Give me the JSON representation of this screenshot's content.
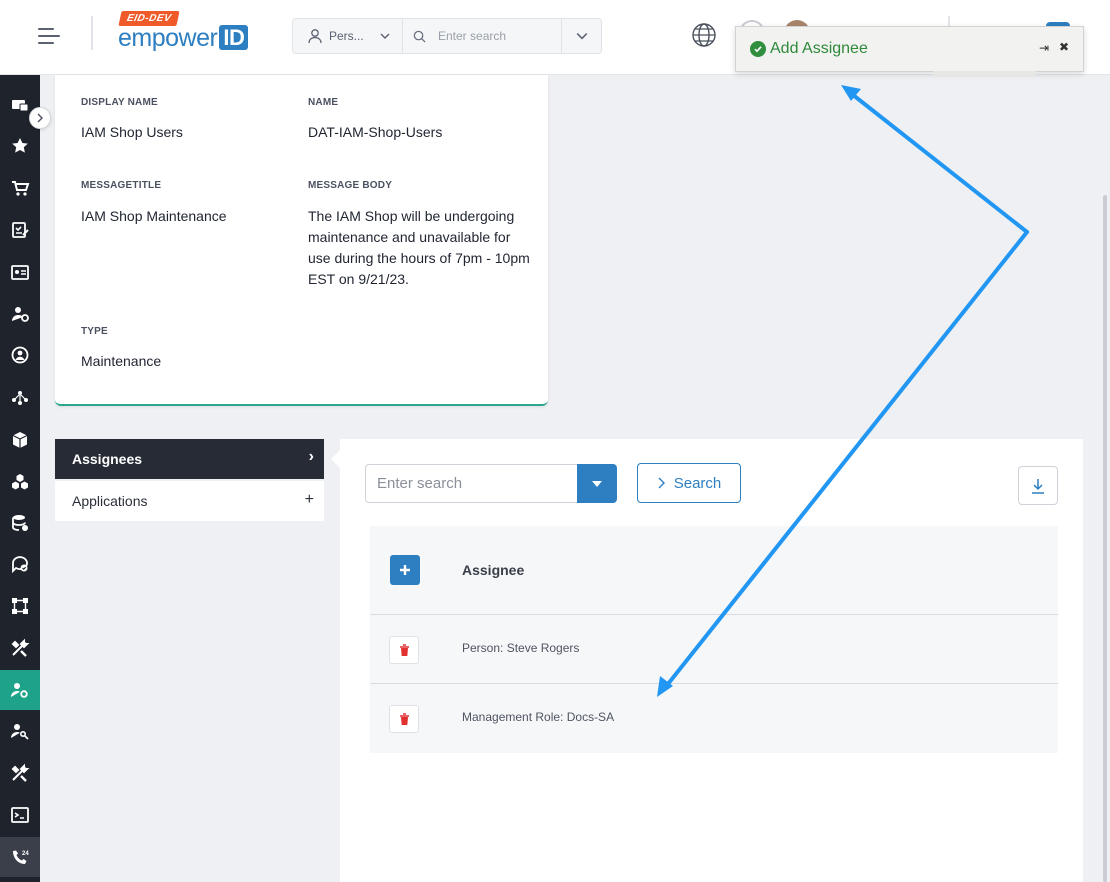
{
  "header": {
    "logo_badge": "EID-DEV",
    "logo_word": "empower",
    "logo_id": "ID",
    "search_type": "Pers...",
    "search_placeholder": "Enter search"
  },
  "toast": {
    "message": "Add Assignee",
    "pin_glyph": "⇥",
    "close_glyph": "✖"
  },
  "details": {
    "display_name_label": "DISPLAY NAME",
    "display_name_value": "IAM Shop Users",
    "name_label": "NAME",
    "name_value": "DAT-IAM-Shop-Users",
    "message_title_label": "MESSAGETITLE",
    "message_title_value": "IAM Shop Maintenance",
    "message_body_label": "MESSAGE BODY",
    "message_body_value": "The IAM Shop will be undergoing maintenance and unavailable for use during the hours of 7pm - 10pm EST on 9/21/23.",
    "type_label": "TYPE",
    "type_value": "Maintenance"
  },
  "tabs": [
    {
      "label": "Assignees",
      "glyph": "›"
    },
    {
      "label": "Applications",
      "glyph": "+"
    }
  ],
  "grid": {
    "search_placeholder": "Enter search",
    "search_button": "Search",
    "column_header": "Assignee",
    "rows": [
      {
        "text": "Person: Steve Rogers"
      },
      {
        "text": "Management Role: Docs-SA"
      }
    ]
  },
  "colors": {
    "brand_blue": "#2d7fc1",
    "sidebar_dark": "#1f232b",
    "sidebar_active": "#1ea38a",
    "toast_green": "#2f8a3a",
    "delete_red": "#e03030",
    "annotation_arrow": "#2196f3"
  },
  "sidebar_icons": [
    "ticket-icon",
    "star-icon",
    "cart-icon",
    "checklist-icon",
    "id-card-icon",
    "people-gear-icon",
    "user-circle-icon",
    "org-chart-icon",
    "box-icon",
    "boxes-icon",
    "database-icon",
    "chat-check-icon",
    "workflow-icon",
    "tools-icon",
    "user-gear-icon",
    "user-key-icon",
    "tools-icon",
    "terminal-icon",
    "phone-24-icon"
  ]
}
